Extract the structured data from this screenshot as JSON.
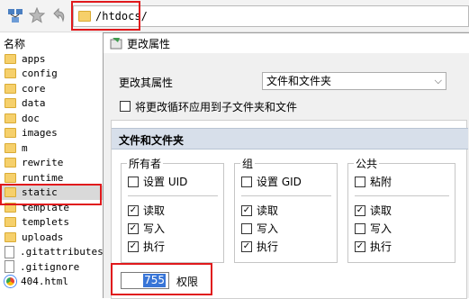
{
  "toolbar": {
    "buttons": [
      "network-icon",
      "star-icon",
      "back-arrow-icon"
    ],
    "path": "/htdocs/"
  },
  "file_list": {
    "header": "名称",
    "items": [
      {
        "name": "apps",
        "type": "folder"
      },
      {
        "name": "config",
        "type": "folder"
      },
      {
        "name": "core",
        "type": "folder"
      },
      {
        "name": "data",
        "type": "folder"
      },
      {
        "name": "doc",
        "type": "folder"
      },
      {
        "name": "images",
        "type": "folder"
      },
      {
        "name": "m",
        "type": "folder"
      },
      {
        "name": "rewrite",
        "type": "folder"
      },
      {
        "name": "runtime",
        "type": "folder"
      },
      {
        "name": "static",
        "type": "folder",
        "selected": true
      },
      {
        "name": "template",
        "type": "folder"
      },
      {
        "name": "templets",
        "type": "folder"
      },
      {
        "name": "uploads",
        "type": "folder"
      },
      {
        "name": ".gitattributes",
        "type": "file"
      },
      {
        "name": ".gitignore",
        "type": "file"
      },
      {
        "name": "404.html",
        "type": "chrome-html"
      }
    ]
  },
  "dialog": {
    "title": "更改属性",
    "change_label": "更改其属性",
    "change_value": "文件和文件夹",
    "recursive_label": "将更改循环应用到子文件夹和文件",
    "recursive_checked": false,
    "section_title": "文件和文件夹",
    "owner": {
      "title": "所有者",
      "setid_label": "设置 UID",
      "setid_checked": false,
      "read_label": "读取",
      "read_checked": true,
      "write_label": "写入",
      "write_checked": true,
      "exec_label": "执行",
      "exec_checked": true
    },
    "group": {
      "title": "组",
      "setid_label": "设置 GID",
      "setid_checked": false,
      "read_label": "读取",
      "read_checked": true,
      "write_label": "写入",
      "write_checked": false,
      "exec_label": "执行",
      "exec_checked": true
    },
    "public": {
      "title": "公共",
      "setid_label": "粘附",
      "setid_checked": false,
      "read_label": "读取",
      "read_checked": true,
      "write_label": "写入",
      "write_checked": false,
      "exec_label": "执行",
      "exec_checked": true
    },
    "permission_value": "755",
    "permission_label": "权限"
  },
  "colors": {
    "highlight_red": "#e0191c",
    "section_bg": "#d7dfea",
    "selection_blue": "#3875d7"
  }
}
